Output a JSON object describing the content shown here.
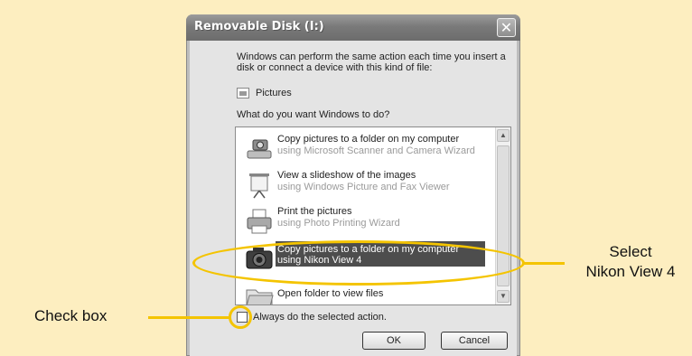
{
  "dialog": {
    "title": "Removable Disk (I:)",
    "close_label": "✕",
    "description": "Windows can perform the same action each time you insert a disk or connect a device with this kind of file:",
    "content_type": "Pictures",
    "question": "What do you want Windows to do?",
    "actions": [
      {
        "title": "Copy pictures to a folder on my computer",
        "subtitle": "using Microsoft Scanner and Camera Wizard",
        "icon": "camera-scanner-icon",
        "selected": false
      },
      {
        "title": "View a slideshow of the images",
        "subtitle": "using Windows Picture and Fax Viewer",
        "icon": "projector-screen-icon",
        "selected": false
      },
      {
        "title": "Print the pictures",
        "subtitle": "using Photo Printing Wizard",
        "icon": "printer-icon",
        "selected": false
      },
      {
        "title": "Copy pictures to a folder on my computer",
        "subtitle": "using Nikon View 4",
        "icon": "nikon-camera-icon",
        "selected": true
      },
      {
        "title": "Open folder to view files",
        "subtitle": "",
        "icon": "folder-icon",
        "selected": false
      }
    ],
    "checkbox_label": "Always do the selected action.",
    "checkbox_checked": false,
    "ok_label": "OK",
    "cancel_label": "Cancel"
  },
  "callouts": {
    "select_line1": "Select",
    "select_line2": "Nikon View 4",
    "checkbox": "Check box"
  },
  "colors": {
    "background": "#fdeec0",
    "highlight": "#f4c400"
  }
}
